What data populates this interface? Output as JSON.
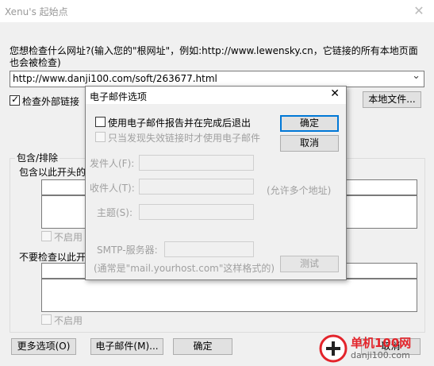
{
  "window": {
    "title": "Xenu's 起始点",
    "close_glyph": "✕"
  },
  "prompt": {
    "line1": "您想检查什么网址?(输入您的\"根网址\"，例如:http://www.lewensky.cn，它链接的所有本地页面",
    "line2": "也会被检查)"
  },
  "url_input": {
    "value": "http://www.danji100.com/soft/263677.html",
    "dropdown_glyph": "⌄"
  },
  "check_external": {
    "label": "检查外部链接",
    "checked": true
  },
  "local_file_button": "本地文件...",
  "include_exclude": {
    "group_label": "包含/排除",
    "include_label": "包含以此开头的",
    "include_disable_label": "不启用",
    "exclude_label": "不要检查以此开",
    "exclude_disable_label": "不启用"
  },
  "bottom_buttons": {
    "more_options": "更多选项(O)",
    "email": "电子邮件(M)...",
    "ok": "确定",
    "cancel": "取消"
  },
  "email_dialog": {
    "title": "电子邮件选项",
    "close_glyph": "✕",
    "use_email_label": "使用电子邮件报告并在完成后退出",
    "only_broken_label": "只当发现失效链接时才使用电子邮件",
    "from_label": "发件人(F):",
    "to_label": "收件人(T):",
    "to_hint": "(允许多个地址)",
    "subject_label": "主题(S):",
    "smtp_label": "SMTP-服务器:",
    "smtp_hint": "(通常是\"mail.yourhost.com\"这样格式的)",
    "ok_button": "确定",
    "cancel_button": "取消",
    "test_button": "测试"
  },
  "watermark": {
    "text": "单机100网",
    "url": "danji100.com"
  },
  "colors": {
    "accent": "#0078d7",
    "watermark_red": "#e3242b"
  }
}
